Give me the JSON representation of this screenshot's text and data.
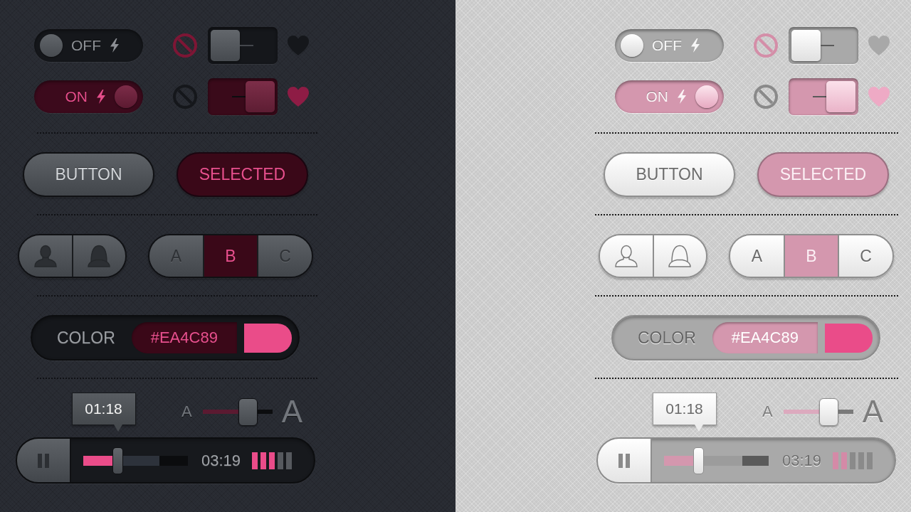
{
  "panels": [
    {
      "kind": "dark",
      "toggle_rows": [
        {
          "power_switch": {
            "label": "OFF",
            "on": false
          },
          "block_active": true,
          "slide_switch": {
            "on": false
          },
          "heart_filled": false
        },
        {
          "power_switch": {
            "label": "ON",
            "on": true
          },
          "block_active": false,
          "slide_switch": {
            "on": true
          },
          "heart_filled": true
        }
      ],
      "buttons": [
        {
          "label": "BUTTON",
          "selected": false
        },
        {
          "label": "SELECTED",
          "selected": true
        }
      ],
      "icon_segments": [
        {
          "selected": false
        },
        {
          "selected": false
        }
      ],
      "letter_segments": [
        {
          "label": "A",
          "selected": false
        },
        {
          "label": "B",
          "selected": true
        },
        {
          "label": "C",
          "selected": false
        }
      ],
      "color_picker": {
        "label": "COLOR",
        "value": "#EA4C89",
        "color": "#ea4c89"
      },
      "text_size": {
        "small_label": "A",
        "large_label": "A",
        "level": 0.65
      },
      "player": {
        "playing": true,
        "tooltip": "01:18",
        "progress": {
          "level": 0.33
        },
        "buffer": {
          "level": 0.73
        },
        "time": "03:19",
        "volume": {
          "level": 0.6
        }
      }
    },
    {
      "kind": "light",
      "toggle_rows": [
        {
          "power_switch": {
            "label": "OFF",
            "on": false
          },
          "block_active": true,
          "slide_switch": {
            "on": false
          },
          "heart_filled": false
        },
        {
          "power_switch": {
            "label": "ON",
            "on": true
          },
          "block_active": false,
          "slide_switch": {
            "on": true
          },
          "heart_filled": true
        }
      ],
      "buttons": [
        {
          "label": "BUTTON",
          "selected": false
        },
        {
          "label": "SELECTED",
          "selected": true
        }
      ],
      "icon_segments": [
        {
          "selected": false
        },
        {
          "selected": false
        }
      ],
      "letter_segments": [
        {
          "label": "A",
          "selected": false
        },
        {
          "label": "B",
          "selected": true
        },
        {
          "label": "C",
          "selected": false
        }
      ],
      "color_picker": {
        "label": "COLOR",
        "value": "#EA4C89",
        "color": "#ea4c89"
      },
      "text_size": {
        "small_label": "A",
        "large_label": "A",
        "level": 0.65
      },
      "player": {
        "playing": true,
        "tooltip": "01:18",
        "progress": {
          "level": 0.33
        },
        "buffer": {
          "level": 0.75
        },
        "time": "03:19",
        "volume": {
          "level": 0.4
        }
      }
    }
  ]
}
